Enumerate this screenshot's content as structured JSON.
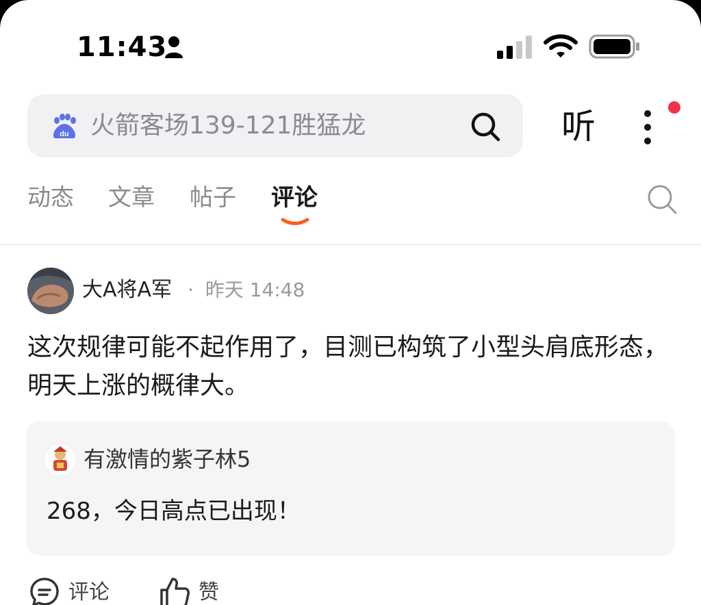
{
  "status_bar": {
    "time": "11:43",
    "icons": [
      "person-icon",
      "cellular-signal-icon",
      "wifi-icon",
      "battery-icon"
    ]
  },
  "header": {
    "search_query": "火箭客场139-121胜猛龙",
    "listen_label": "听",
    "icons": [
      "baidu-logo",
      "search-icon",
      "more-icon"
    ],
    "notification_dot_color": "#f1334c"
  },
  "tabs": {
    "items": [
      {
        "label": "动态",
        "active": false
      },
      {
        "label": "文章",
        "active": false
      },
      {
        "label": "帖子",
        "active": false
      },
      {
        "label": "评论",
        "active": true
      }
    ],
    "accent_color": "#ff5a1f"
  },
  "post": {
    "author": "大A将A军",
    "separator": "·",
    "time": "昨天 14:48",
    "body": "这次规律可能不起作用了，目测已构筑了小型头肩底形态，明天上涨的概律大。",
    "quote": {
      "user": "有激情的紫子林5",
      "text": "268，今日高点已出现！"
    },
    "actions": {
      "comment_label": "评论",
      "like_label": "赞"
    }
  }
}
